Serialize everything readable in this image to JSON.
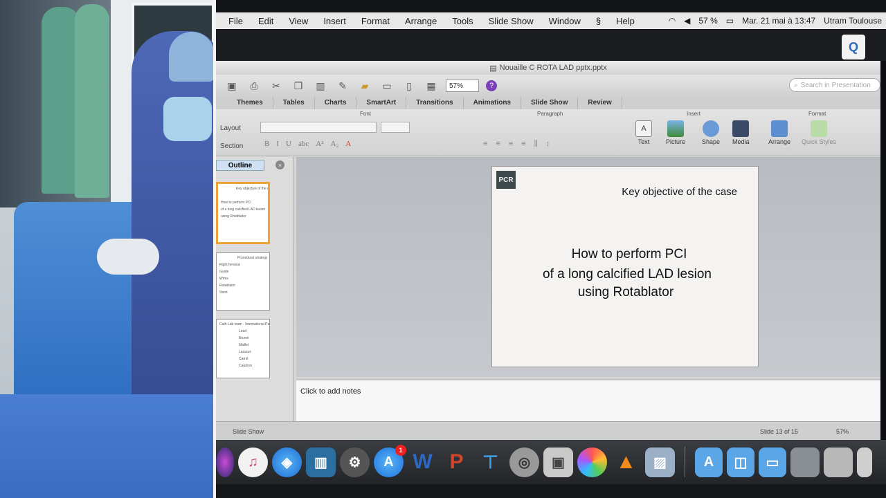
{
  "menubar": {
    "items": [
      "File",
      "Edit",
      "View",
      "Insert",
      "Format",
      "Arrange",
      "Tools",
      "Slide Show",
      "Window",
      "Help"
    ],
    "battery": "57 %",
    "datetime": "Mar. 21 mai à 13:47",
    "user": "Utram Toulouse"
  },
  "window": {
    "title": "Nouaille C ROTA LAD pptx.pptx",
    "zoom": "57%",
    "search_placeholder": "Search in Presentation"
  },
  "ribbon": {
    "tabs": [
      "Themes",
      "Tables",
      "Charts",
      "SmartArt",
      "Transitions",
      "Animations",
      "Slide Show",
      "Review"
    ],
    "groups": {
      "font": "Font",
      "paragraph": "Paragraph",
      "insert": "Insert",
      "format": "Format"
    },
    "layout_label": "Layout",
    "section_label": "Section",
    "insert_buttons": [
      "Text",
      "Picture",
      "Shape",
      "Media"
    ],
    "format_buttons": [
      "Arrange",
      "Quick Styles"
    ]
  },
  "slides_pane": {
    "outline_tab": "Outline",
    "thumbs": [
      {
        "lines": [
          "Key objective of the case",
          "How to perform PCI",
          "of a long calcified LAD lesion",
          "using Rotablator"
        ]
      },
      {
        "lines": [
          "Procedural strategy",
          "Right femoral",
          "Guide",
          "Wires",
          "Rotablator",
          "Stent"
        ]
      },
      {
        "lines": [
          "Cath Lab team - International Panel",
          "Lead",
          "Brunel",
          "Maillet",
          "Lazarus",
          "Carrié",
          "Caudron",
          "Carrié"
        ]
      }
    ]
  },
  "slide": {
    "logo": "PCR",
    "title": "Key objective of the case",
    "body": [
      "How to perform PCI",
      "of a long calcified LAD lesion",
      "using Rotablator"
    ]
  },
  "notes_placeholder": "Click to add notes",
  "status": {
    "view": "Slide Show",
    "slide_counter": "Slide 13 of 15",
    "zoom": "57%"
  },
  "dock": {
    "apps": [
      "Siri",
      "iTunes",
      "Safari",
      "Photo Booth",
      "Preview",
      "App Store",
      "Word",
      "PowerPoint",
      "Keynote",
      "DVD Player",
      "Preview",
      "Photos",
      "VLC",
      "Image Capture"
    ],
    "badge_app": "App Store",
    "badge_count": "1"
  },
  "colors": {
    "accent_blue": "#2a69b8",
    "selection_orange": "#f0a23a",
    "ribbon": "#d2d2d2"
  }
}
